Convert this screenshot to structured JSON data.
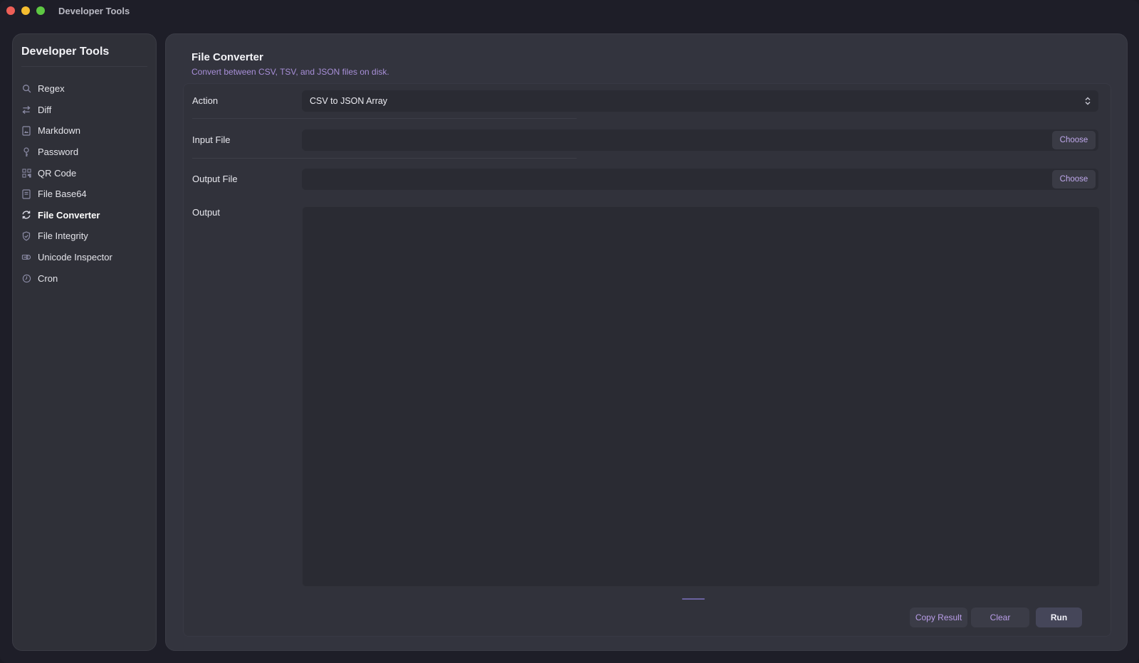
{
  "window": {
    "title": "Developer Tools"
  },
  "sidebar": {
    "title": "Developer Tools",
    "items": [
      {
        "label": "Regex",
        "icon": "search-icon",
        "active": false
      },
      {
        "label": "Diff",
        "icon": "arrows-swap-icon",
        "active": false
      },
      {
        "label": "Markdown",
        "icon": "document-image-icon",
        "active": false
      },
      {
        "label": "Password",
        "icon": "key-icon",
        "active": false
      },
      {
        "label": "QR Code",
        "icon": "qrcode-icon",
        "active": false
      },
      {
        "label": "File Base64",
        "icon": "file-icon",
        "active": false
      },
      {
        "label": "File Converter",
        "icon": "refresh-icon",
        "active": true
      },
      {
        "label": "File Integrity",
        "icon": "shield-check-icon",
        "active": false
      },
      {
        "label": "Unicode Inspector",
        "icon": "glyph-icon",
        "active": false
      },
      {
        "label": "Cron",
        "icon": "clock-icon",
        "active": false
      }
    ]
  },
  "main": {
    "title": "File Converter",
    "subtitle": "Convert between CSV, TSV, and JSON files on disk.",
    "action": {
      "label": "Action",
      "value": "CSV to JSON Array"
    },
    "input_file": {
      "label": "Input File",
      "value": "",
      "button": "Choose"
    },
    "output_file": {
      "label": "Output File",
      "value": "",
      "button": "Choose"
    },
    "output": {
      "label": "Output",
      "value": ""
    },
    "buttons": {
      "copy": "Copy Result",
      "clear": "Clear",
      "run": "Run"
    }
  },
  "colors": {
    "accent": "#a88fd8",
    "active_nav": "#ffffff",
    "panel": "#33343e"
  }
}
